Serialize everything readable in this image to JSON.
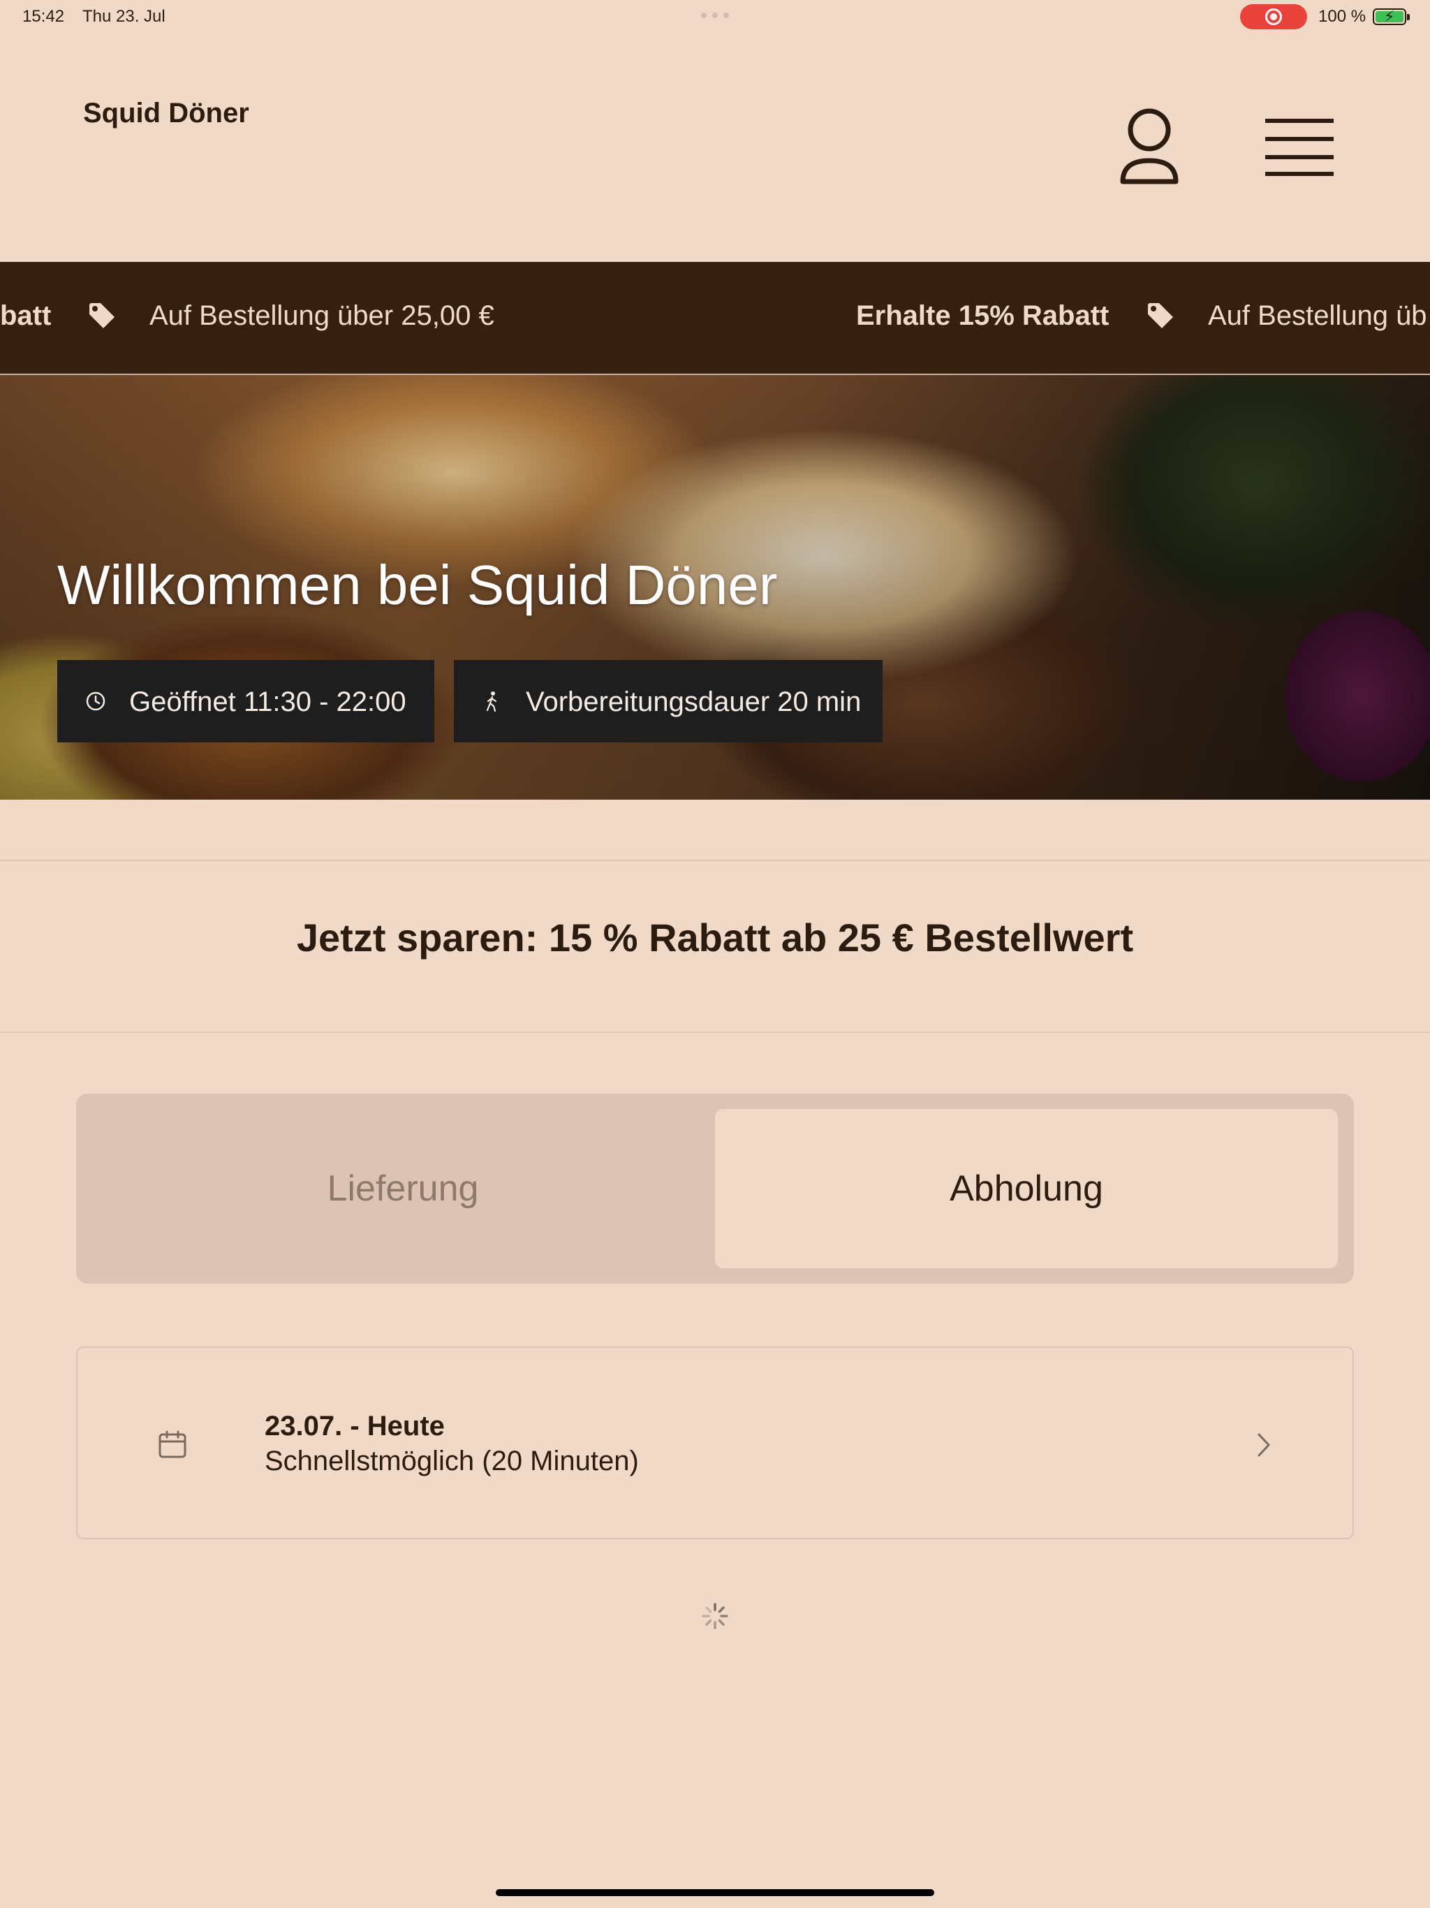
{
  "status_bar": {
    "time": "15:42",
    "date": "Thu 23. Jul",
    "battery": "100 %"
  },
  "header": {
    "brand": "Squid Döner",
    "icons": {
      "account": "user-icon",
      "menu": "hamburger-menu-icon"
    }
  },
  "ticker": {
    "items": [
      {
        "bold": "batt",
        "text": "Auf Bestellung über 25,00 €"
      },
      {
        "bold": "Erhalte 15% Rabatt",
        "text": "Auf Bestellung üb"
      }
    ],
    "icon": "tag-icon"
  },
  "hero": {
    "title": "Willkommen bei Squid Döner",
    "opening_hours": "Geöffnet 11:30 - 22:00",
    "prep_time": "Vorbereitungsdauer 20 min"
  },
  "promo": {
    "text": "Jetzt sparen: 15 % Rabatt ab 25 € Bestellwert"
  },
  "order_mode": {
    "options": [
      "Lieferung",
      "Abholung"
    ],
    "selected": "Abholung"
  },
  "pickup_time": {
    "title": "23.07. - Heute",
    "subtitle": "Schnellstmöglich (20 Minuten)"
  },
  "colors": {
    "background": "#f1d9c8",
    "text": "#2c1c10",
    "ticker_bg": "#33200f",
    "segment_bg": "#dcc3b4",
    "chip_bg": "#1e1e1e",
    "recording": "#e8423a"
  }
}
